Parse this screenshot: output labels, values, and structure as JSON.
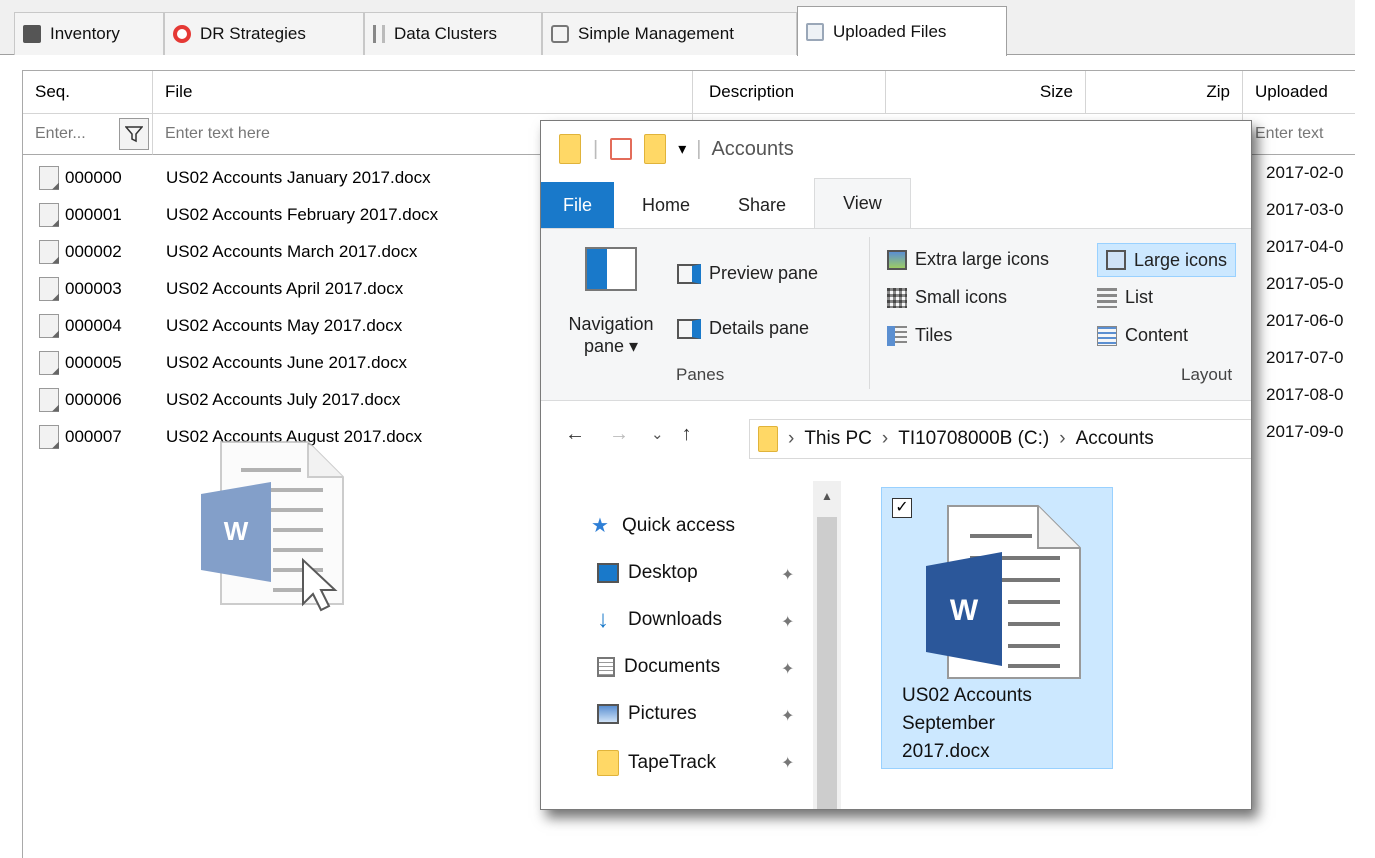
{
  "tabs": [
    {
      "label": "Inventory",
      "icon": "inventory-icon"
    },
    {
      "label": "DR Strategies",
      "icon": "lifebuoy-icon"
    },
    {
      "label": "Data Clusters",
      "icon": "cluster-icon"
    },
    {
      "label": "Simple Management",
      "icon": "clock-icon"
    },
    {
      "label": "Uploaded Files",
      "icon": "folder-icon",
      "active": true
    }
  ],
  "grid": {
    "columns": {
      "seq": "Seq.",
      "file": "File",
      "description": "Description",
      "size": "Size",
      "zip": "Zip",
      "uploaded": "Uploaded"
    },
    "filters": {
      "seq": "Enter...",
      "file": "Enter text here",
      "uploaded": "Enter text"
    },
    "rows": [
      {
        "seq": "000000",
        "file": "US02 Accounts January 2017.docx",
        "uploaded": "2017-02-0"
      },
      {
        "seq": "000001",
        "file": "US02 Accounts February 2017.docx",
        "uploaded": "2017-03-0"
      },
      {
        "seq": "000002",
        "file": "US02 Accounts March 2017.docx",
        "uploaded": "2017-04-0"
      },
      {
        "seq": "000003",
        "file": "US02 Accounts April 2017.docx",
        "uploaded": "2017-05-0"
      },
      {
        "seq": "000004",
        "file": "US02 Accounts May 2017.docx",
        "uploaded": "2017-06-0"
      },
      {
        "seq": "000005",
        "file": "US02 Accounts June 2017.docx",
        "uploaded": "2017-07-0"
      },
      {
        "seq": "000006",
        "file": "US02 Accounts July 2017.docx",
        "uploaded": "2017-08-0"
      },
      {
        "seq": "000007",
        "file": "US02 Accounts August 2017.docx",
        "uploaded": "2017-09-0"
      }
    ],
    "drag_icon_letter": "W"
  },
  "explorer": {
    "title": "Accounts",
    "ribbon_tabs": [
      "File",
      "Home",
      "Share",
      "View"
    ],
    "panes": {
      "nav_pane_line1": "Navigation",
      "nav_pane_line2": "pane ▾",
      "preview": "Preview pane",
      "details": "Details pane",
      "group": "Panes"
    },
    "layout": {
      "extra_large": "Extra large icons",
      "large": "Large icons",
      "small": "Small icons",
      "list": "List",
      "tiles": "Tiles",
      "content": "Content",
      "group": "Layout"
    },
    "address": {
      "back": "←",
      "forward": "→",
      "recent": "⌄",
      "up": "↑",
      "path": [
        "This PC",
        "TI10708000B (C:)",
        "Accounts"
      ],
      "sep": "›"
    },
    "nav_items": [
      {
        "label": "Quick access"
      },
      {
        "label": "Desktop"
      },
      {
        "label": "Downloads"
      },
      {
        "label": "Documents"
      },
      {
        "label": "Pictures"
      },
      {
        "label": "TapeTrack"
      }
    ],
    "selected_file": {
      "name": "US02 Accounts September 2017.docx",
      "line1": "US02 Accounts",
      "line2": "September",
      "line3": "2017.docx",
      "icon_letter": "W"
    }
  }
}
